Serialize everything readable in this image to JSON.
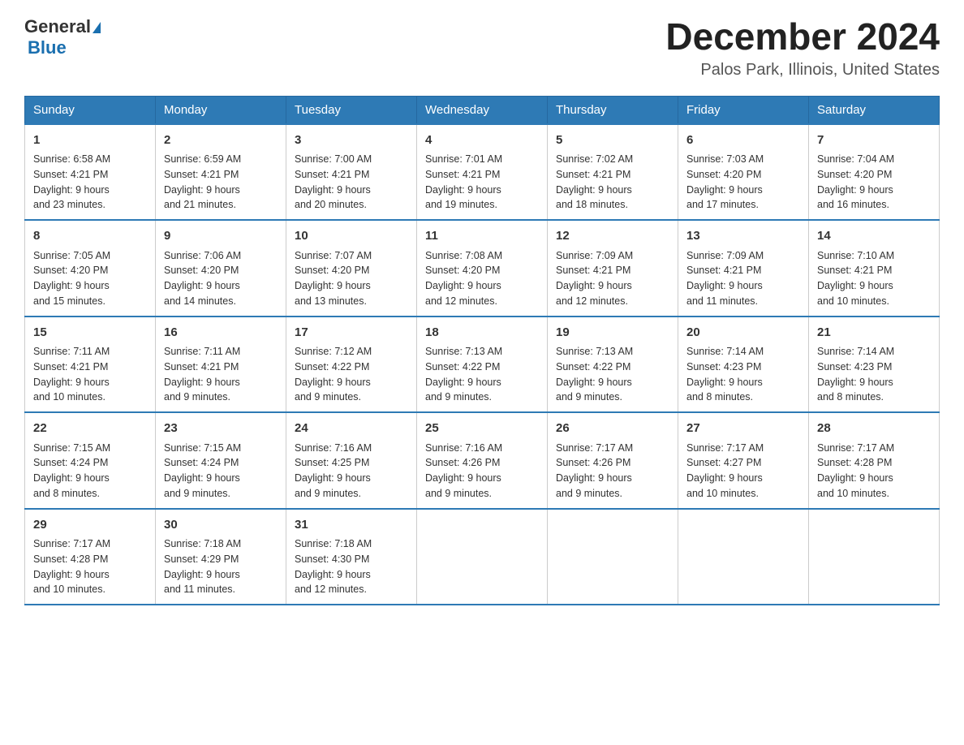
{
  "header": {
    "logo_general": "General",
    "logo_blue": "Blue",
    "title": "December 2024",
    "subtitle": "Palos Park, Illinois, United States"
  },
  "days_of_week": [
    "Sunday",
    "Monday",
    "Tuesday",
    "Wednesday",
    "Thursday",
    "Friday",
    "Saturday"
  ],
  "weeks": [
    [
      {
        "day": "1",
        "sunrise": "6:58 AM",
        "sunset": "4:21 PM",
        "daylight": "9 hours and 23 minutes."
      },
      {
        "day": "2",
        "sunrise": "6:59 AM",
        "sunset": "4:21 PM",
        "daylight": "9 hours and 21 minutes."
      },
      {
        "day": "3",
        "sunrise": "7:00 AM",
        "sunset": "4:21 PM",
        "daylight": "9 hours and 20 minutes."
      },
      {
        "day": "4",
        "sunrise": "7:01 AM",
        "sunset": "4:21 PM",
        "daylight": "9 hours and 19 minutes."
      },
      {
        "day": "5",
        "sunrise": "7:02 AM",
        "sunset": "4:21 PM",
        "daylight": "9 hours and 18 minutes."
      },
      {
        "day": "6",
        "sunrise": "7:03 AM",
        "sunset": "4:20 PM",
        "daylight": "9 hours and 17 minutes."
      },
      {
        "day": "7",
        "sunrise": "7:04 AM",
        "sunset": "4:20 PM",
        "daylight": "9 hours and 16 minutes."
      }
    ],
    [
      {
        "day": "8",
        "sunrise": "7:05 AM",
        "sunset": "4:20 PM",
        "daylight": "9 hours and 15 minutes."
      },
      {
        "day": "9",
        "sunrise": "7:06 AM",
        "sunset": "4:20 PM",
        "daylight": "9 hours and 14 minutes."
      },
      {
        "day": "10",
        "sunrise": "7:07 AM",
        "sunset": "4:20 PM",
        "daylight": "9 hours and 13 minutes."
      },
      {
        "day": "11",
        "sunrise": "7:08 AM",
        "sunset": "4:20 PM",
        "daylight": "9 hours and 12 minutes."
      },
      {
        "day": "12",
        "sunrise": "7:09 AM",
        "sunset": "4:21 PM",
        "daylight": "9 hours and 12 minutes."
      },
      {
        "day": "13",
        "sunrise": "7:09 AM",
        "sunset": "4:21 PM",
        "daylight": "9 hours and 11 minutes."
      },
      {
        "day": "14",
        "sunrise": "7:10 AM",
        "sunset": "4:21 PM",
        "daylight": "9 hours and 10 minutes."
      }
    ],
    [
      {
        "day": "15",
        "sunrise": "7:11 AM",
        "sunset": "4:21 PM",
        "daylight": "9 hours and 10 minutes."
      },
      {
        "day": "16",
        "sunrise": "7:11 AM",
        "sunset": "4:21 PM",
        "daylight": "9 hours and 9 minutes."
      },
      {
        "day": "17",
        "sunrise": "7:12 AM",
        "sunset": "4:22 PM",
        "daylight": "9 hours and 9 minutes."
      },
      {
        "day": "18",
        "sunrise": "7:13 AM",
        "sunset": "4:22 PM",
        "daylight": "9 hours and 9 minutes."
      },
      {
        "day": "19",
        "sunrise": "7:13 AM",
        "sunset": "4:22 PM",
        "daylight": "9 hours and 9 minutes."
      },
      {
        "day": "20",
        "sunrise": "7:14 AM",
        "sunset": "4:23 PM",
        "daylight": "9 hours and 8 minutes."
      },
      {
        "day": "21",
        "sunrise": "7:14 AM",
        "sunset": "4:23 PM",
        "daylight": "9 hours and 8 minutes."
      }
    ],
    [
      {
        "day": "22",
        "sunrise": "7:15 AM",
        "sunset": "4:24 PM",
        "daylight": "9 hours and 8 minutes."
      },
      {
        "day": "23",
        "sunrise": "7:15 AM",
        "sunset": "4:24 PM",
        "daylight": "9 hours and 9 minutes."
      },
      {
        "day": "24",
        "sunrise": "7:16 AM",
        "sunset": "4:25 PM",
        "daylight": "9 hours and 9 minutes."
      },
      {
        "day": "25",
        "sunrise": "7:16 AM",
        "sunset": "4:26 PM",
        "daylight": "9 hours and 9 minutes."
      },
      {
        "day": "26",
        "sunrise": "7:17 AM",
        "sunset": "4:26 PM",
        "daylight": "9 hours and 9 minutes."
      },
      {
        "day": "27",
        "sunrise": "7:17 AM",
        "sunset": "4:27 PM",
        "daylight": "9 hours and 10 minutes."
      },
      {
        "day": "28",
        "sunrise": "7:17 AM",
        "sunset": "4:28 PM",
        "daylight": "9 hours and 10 minutes."
      }
    ],
    [
      {
        "day": "29",
        "sunrise": "7:17 AM",
        "sunset": "4:28 PM",
        "daylight": "9 hours and 10 minutes."
      },
      {
        "day": "30",
        "sunrise": "7:18 AM",
        "sunset": "4:29 PM",
        "daylight": "9 hours and 11 minutes."
      },
      {
        "day": "31",
        "sunrise": "7:18 AM",
        "sunset": "4:30 PM",
        "daylight": "9 hours and 12 minutes."
      },
      null,
      null,
      null,
      null
    ]
  ]
}
